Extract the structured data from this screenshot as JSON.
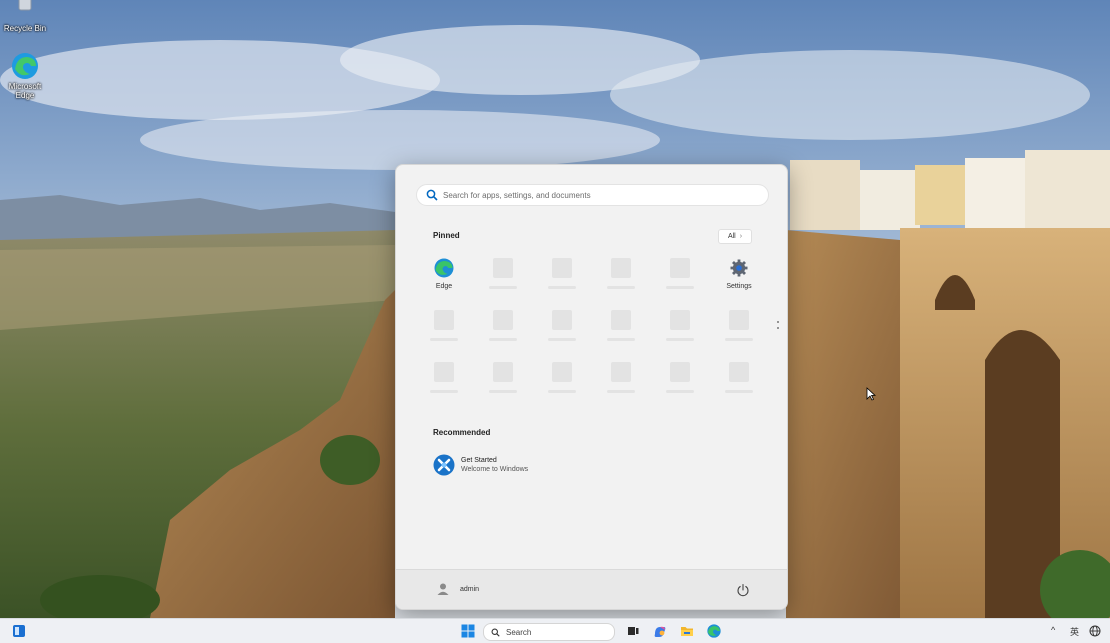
{
  "desktop": {
    "icons": [
      {
        "label": "Recycle Bin",
        "icon": "recycle-bin-icon"
      },
      {
        "label": "Microsoft Edge",
        "icon": "edge-icon"
      }
    ]
  },
  "start_menu": {
    "search": {
      "placeholder": "Search for apps, settings, and documents",
      "icon": "search-icon"
    },
    "pinned": {
      "title": "Pinned",
      "all_button": "All",
      "apps": [
        {
          "label": "Edge",
          "icon": "edge-icon"
        },
        {
          "label": "Settings",
          "icon": "settings-gear-icon"
        }
      ]
    },
    "recommended": {
      "title": "Recommended",
      "items": [
        {
          "title": "Get Started",
          "subtitle": "Welcome to Windows",
          "icon": "get-started-icon"
        }
      ]
    },
    "footer": {
      "user": "admin",
      "power_icon": "power-icon"
    }
  },
  "taskbar": {
    "search_label": "Search",
    "items": [
      "widgets-icon",
      "start-icon",
      "search-icon",
      "task-view-icon",
      "copilot-icon",
      "file-explorer-icon",
      "edge-icon"
    ],
    "tray": {
      "chevron": "^",
      "ime": "英",
      "network_icon": "globe-icon"
    }
  },
  "colors": {
    "accent": "#0067c0",
    "menu_bg": "#f2f2f2",
    "taskbar_bg": "#eef0f4"
  }
}
